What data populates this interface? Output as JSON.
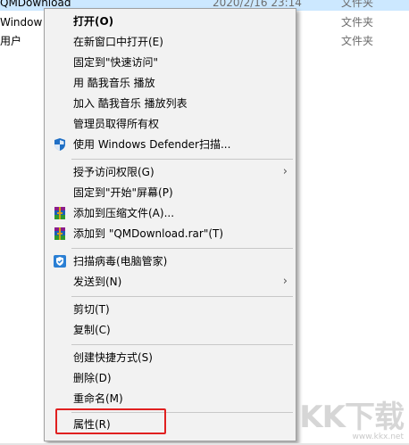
{
  "explorer": {
    "rows": [
      {
        "name": "QMDownload",
        "date": "2020/2/16 23:14",
        "type": "文件夹"
      },
      {
        "name": "Window",
        "date": "",
        "type": "文件夹"
      },
      {
        "name": "用户",
        "date": "",
        "type": "文件夹"
      }
    ]
  },
  "menu": {
    "items": [
      {
        "label": "打开(O)"
      },
      {
        "label": "在新窗口中打开(E)"
      },
      {
        "label": "固定到\"快速访问\""
      },
      {
        "label": "用 酷我音乐 播放"
      },
      {
        "label": "加入 酷我音乐 播放列表"
      },
      {
        "label": "管理员取得所有权"
      },
      {
        "label": "使用 Windows Defender扫描..."
      },
      {
        "label": "授予访问权限(G)"
      },
      {
        "label": "固定到\"开始\"屏幕(P)"
      },
      {
        "label": "添加到压缩文件(A)..."
      },
      {
        "label": "添加到 \"QMDownload.rar\"(T)"
      },
      {
        "label": "扫描病毒(电脑管家)"
      },
      {
        "label": "发送到(N)"
      },
      {
        "label": "剪切(T)"
      },
      {
        "label": "复制(C)"
      },
      {
        "label": "创建快捷方式(S)"
      },
      {
        "label": "删除(D)"
      },
      {
        "label": "重命名(M)"
      },
      {
        "label": "属性(R)"
      }
    ],
    "icons": {
      "defender": "shield-icon",
      "winrar": "winrar-icon",
      "guanjia": "guanjia-shield-icon",
      "submenu": "chevron-right-icon"
    },
    "highlight_color": "#e02020"
  },
  "watermark": {
    "logo": "KK下载",
    "url": "www.kkx.net"
  }
}
